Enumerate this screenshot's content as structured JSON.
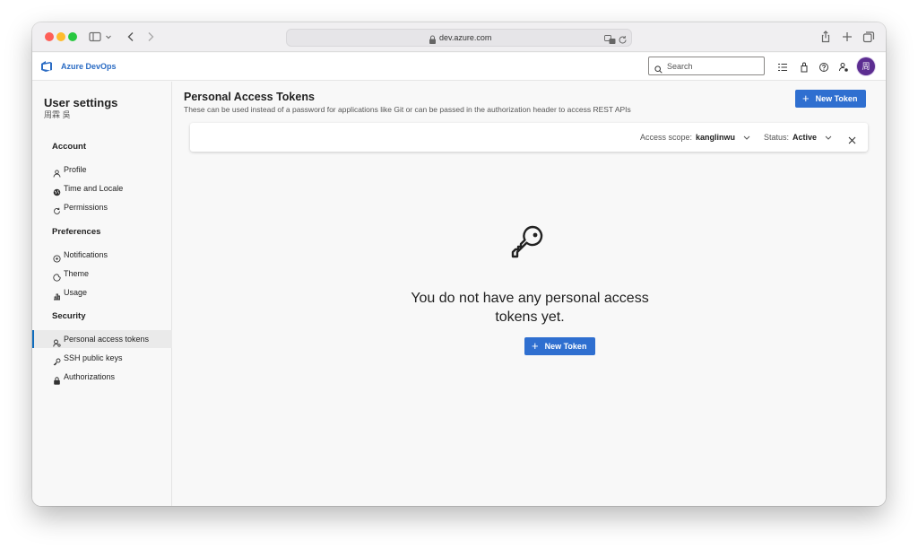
{
  "browser": {
    "url": "dev.azure.com"
  },
  "header": {
    "brand": "Azure DevOps",
    "search_placeholder": "Search",
    "avatar_initial": "周"
  },
  "sidebar": {
    "title": "User settings",
    "user_name": "周霖 吳",
    "sections": [
      {
        "label": "Account",
        "items": [
          {
            "label": "Profile",
            "icon": "person-icon"
          },
          {
            "label": "Time and Locale",
            "icon": "globe-icon"
          },
          {
            "label": "Permissions",
            "icon": "permissions-icon"
          }
        ]
      },
      {
        "label": "Preferences",
        "items": [
          {
            "label": "Notifications",
            "icon": "notification-icon"
          },
          {
            "label": "Theme",
            "icon": "theme-icon"
          },
          {
            "label": "Usage",
            "icon": "usage-icon"
          }
        ]
      },
      {
        "label": "Security",
        "items": [
          {
            "label": "Personal access tokens",
            "icon": "token-icon",
            "selected": true
          },
          {
            "label": "SSH public keys",
            "icon": "key-icon"
          },
          {
            "label": "Authorizations",
            "icon": "lock-icon"
          }
        ]
      }
    ]
  },
  "main": {
    "title": "Personal Access Tokens",
    "description": "These can be used instead of a password for applications like Git or can be passed in the authorization header to access REST APIs",
    "new_token_label": "New Token",
    "filters": {
      "scope_label": "Access scope:",
      "scope_value": "kanglinwu",
      "status_label": "Status:",
      "status_value": "Active"
    },
    "empty_state": {
      "message": "You do not have any personal access tokens yet.",
      "button_label": "New Token"
    }
  },
  "colors": {
    "primary": "#2f6fd0",
    "brand": "#2b6cc4",
    "avatar": "#5c2d91",
    "selected_indicator": "#0f6cbd"
  }
}
